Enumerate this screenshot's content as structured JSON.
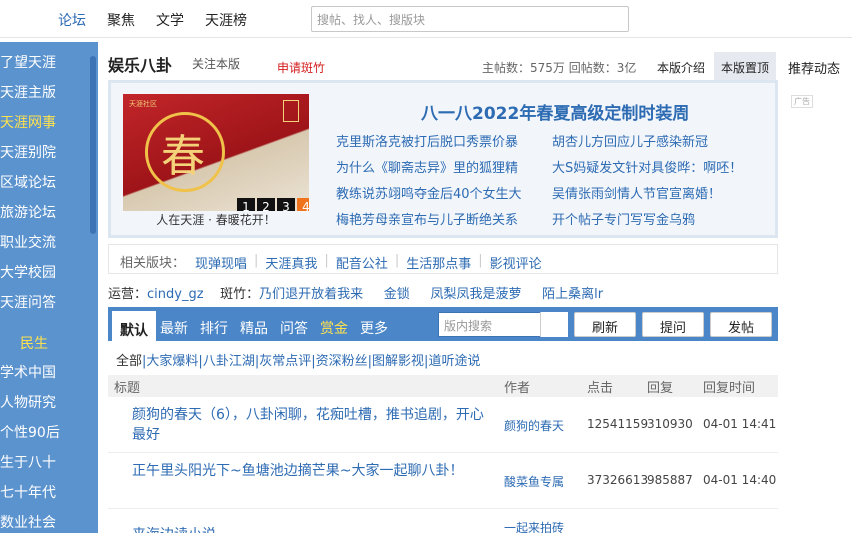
{
  "topnav": [
    "论坛",
    "聚焦",
    "文学",
    "天涯榜"
  ],
  "search_placeholder": "搜帖、找人、搜版块",
  "sidebar": {
    "items": [
      "了望天涯",
      "天涯主版",
      "天涯网事",
      "天涯别院",
      "区域论坛",
      "旅游论坛",
      "职业交流",
      "大学校园",
      "天涯问答"
    ],
    "section": "民生",
    "items2": [
      "学术中国",
      "人物研究",
      "个性90后",
      "生于八十",
      "七十年代",
      "数业社会"
    ]
  },
  "forum": {
    "title": "娱乐八卦",
    "follow": "关注本版",
    "apply": "申请斑竹",
    "stats": "主帖数：575万 回帖数：3亿",
    "tab_intro": "本版介绍",
    "tab_top": "本版置顶",
    "tab_rec": "推荐动态",
    "ad": "广告"
  },
  "featured": {
    "title": "八一八2022年春夏高级定制时装周",
    "caption": "人在天涯 · 春暖花开！",
    "banner_text": "天涯社区",
    "banner_glyph": "春",
    "pages": [
      "1",
      "2",
      "3",
      "4"
    ],
    "links_left": [
      "克里斯洛克被打后脱口秀票价暴",
      "为什么《聊斋志异》里的狐狸精",
      "教练说苏翊鸣夺金后40个女生大",
      "梅艳芳母亲宣布与儿子断绝关系"
    ],
    "links_right": [
      "胡杏儿方回应儿子感染新冠",
      "大S妈疑发文针对具俊晔：啊呸！",
      "吴倩张雨剑情人节官宣离婚！",
      "开个帖子专门写写金乌鸦"
    ]
  },
  "related": {
    "label": "相关版块：",
    "links": [
      "现弹现唱",
      "天涯真我",
      "配音公社",
      "生活那点事",
      "影视评论"
    ]
  },
  "mods": {
    "ops_label": "运营：",
    "ops": "cindy_gz",
    "bz_label": "斑竹：",
    "bz": [
      "乃们退开放着我来",
      "金锁",
      "凤梨凤我是菠萝",
      "陌上桑离lr"
    ]
  },
  "tabs": [
    "默认",
    "最新",
    "排行",
    "精品",
    "问答",
    "赏金",
    "更多"
  ],
  "board_search_placeholder": "版内搜索",
  "buttons": [
    "刷新",
    "提问",
    "发帖"
  ],
  "cats_all": "全部",
  "cats": [
    "大家爆料",
    "八卦江湖",
    "灰常点评",
    "资深粉丝",
    "图解影视",
    "道听途说"
  ],
  "table": {
    "headers": [
      "标题",
      "作者",
      "点击",
      "回复",
      "回复时间"
    ],
    "rows": [
      {
        "title": "颜狗的春天（6），八卦闲聊，花痴吐槽，推书追剧，开心最好",
        "author": "颜狗的春天",
        "clicks": "12541159",
        "replies": "310930",
        "time": "04-01 14:41"
      },
      {
        "title": "正午里头阳光下~鱼塘池边摘芒果~大家一起聊八卦！",
        "author": "酸菜鱼专属",
        "clicks": "37326613",
        "replies": "985887",
        "time": "04-01 14:40"
      },
      {
        "title": "来海边读小说",
        "author": "一起来拍砖",
        "clicks": "",
        "replies": "",
        "time": ""
      }
    ]
  },
  "colors": {
    "brand_blue": "#5b93cf",
    "link_blue": "#2d6bb3",
    "accent_red": "#d41e1e",
    "highlight_yellow": "#ffe24d"
  }
}
